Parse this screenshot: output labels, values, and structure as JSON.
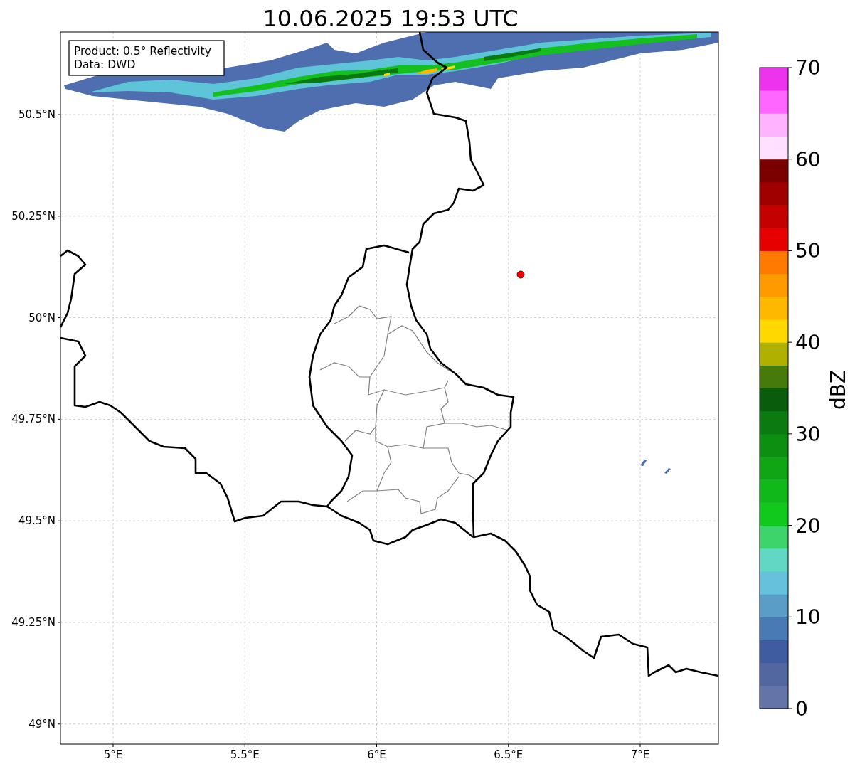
{
  "title": "10.06.2025 19:53 UTC",
  "info_box": {
    "lines": [
      "Product: 0.5° Reflectivity",
      "Data: DWD"
    ]
  },
  "map": {
    "x_ticks": [
      "5°E",
      "5.5°E",
      "6°E",
      "6.5°E",
      "7°E"
    ],
    "y_ticks": [
      "50.5°N",
      "50.25°N",
      "50°N",
      "49.75°N",
      "49.5°N",
      "49.25°N",
      "49°N"
    ]
  },
  "colorbar": {
    "label": "dBZ",
    "ticks": [
      "70",
      "60",
      "50",
      "40",
      "30",
      "20",
      "10",
      "0"
    ],
    "bins": [
      {
        "color": "#6574a8"
      },
      {
        "color": "#52669f"
      },
      {
        "color": "#405ca0"
      },
      {
        "color": "#4a7ab4"
      },
      {
        "color": "#5a9ec8"
      },
      {
        "color": "#66c1dc"
      },
      {
        "color": "#62d8c4"
      },
      {
        "color": "#3dd46c"
      },
      {
        "color": "#11c91c"
      },
      {
        "color": "#10b81a"
      },
      {
        "color": "#0fa514"
      },
      {
        "color": "#0d8f12"
      },
      {
        "color": "#0b7a10"
      },
      {
        "color": "#085c0c"
      },
      {
        "color": "#467a0b"
      },
      {
        "color": "#b0b000"
      },
      {
        "color": "#ffd800"
      },
      {
        "color": "#ffb800"
      },
      {
        "color": "#ff9a00"
      },
      {
        "color": "#ff7a00"
      },
      {
        "color": "#e60000"
      },
      {
        "color": "#c40000"
      },
      {
        "color": "#a00000"
      },
      {
        "color": "#7a0000"
      },
      {
        "color": "#ffe0ff"
      },
      {
        "color": "#ffb3ff"
      },
      {
        "color": "#ff66ff"
      },
      {
        "color": "#ee33ee"
      }
    ]
  }
}
